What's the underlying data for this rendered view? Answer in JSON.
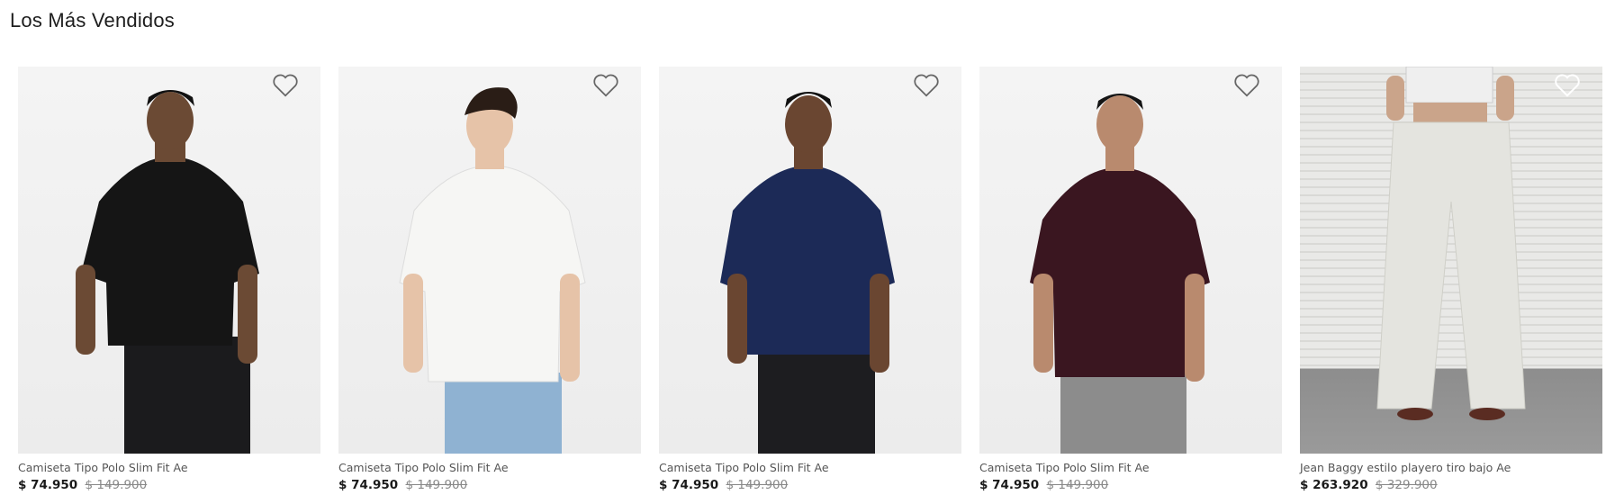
{
  "section": {
    "title": "Los Más Vendidos"
  },
  "products": [
    {
      "name": "Camiseta Tipo Polo Slim Fit Ae",
      "price": "$ 74.950",
      "old_price": "$ 149.900",
      "shirt_color": "#151515",
      "pants_color": "#1b1b1d"
    },
    {
      "name": "Camiseta Tipo Polo Slim Fit Ae",
      "price": "$ 74.950",
      "old_price": "$ 149.900",
      "shirt_color": "#f6f6f4",
      "pants_color": "#8fb2d2"
    },
    {
      "name": "Camiseta Tipo Polo Slim Fit Ae",
      "price": "$ 74.950",
      "old_price": "$ 149.900",
      "shirt_color": "#1c2a57",
      "pants_color": "#1d1d20"
    },
    {
      "name": "Camiseta Tipo Polo Slim Fit Ae",
      "price": "$ 74.950",
      "old_price": "$ 149.900",
      "shirt_color": "#3a1620",
      "pants_color": "#8c8c8c"
    },
    {
      "name": "Jean Baggy estilo playero tiro bajo Ae",
      "price": "$ 263.920",
      "old_price": "$ 329.900",
      "shirt_color": "#efefef",
      "pants_color": "#e4e4df"
    }
  ],
  "icons": {
    "favorite": "heart-outline-icon"
  }
}
